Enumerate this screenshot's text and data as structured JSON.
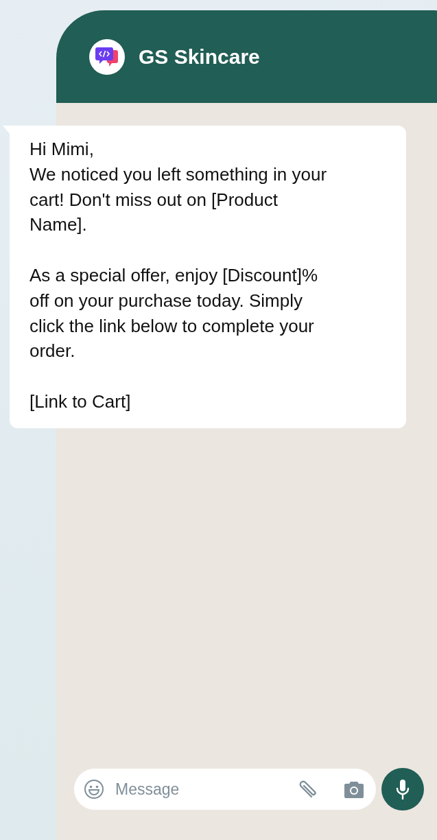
{
  "chat": {
    "title": "GS Skincare"
  },
  "message": {
    "text": "Hi Mimi,\nWe noticed you left something in your cart! Don't miss out on [Product Name].\n\nAs a special offer, enjoy [Discount]% off on your purchase today. Simply click the link below to complete your order.\n\n[Link to Cart]"
  },
  "composer": {
    "placeholder": "Message"
  }
}
